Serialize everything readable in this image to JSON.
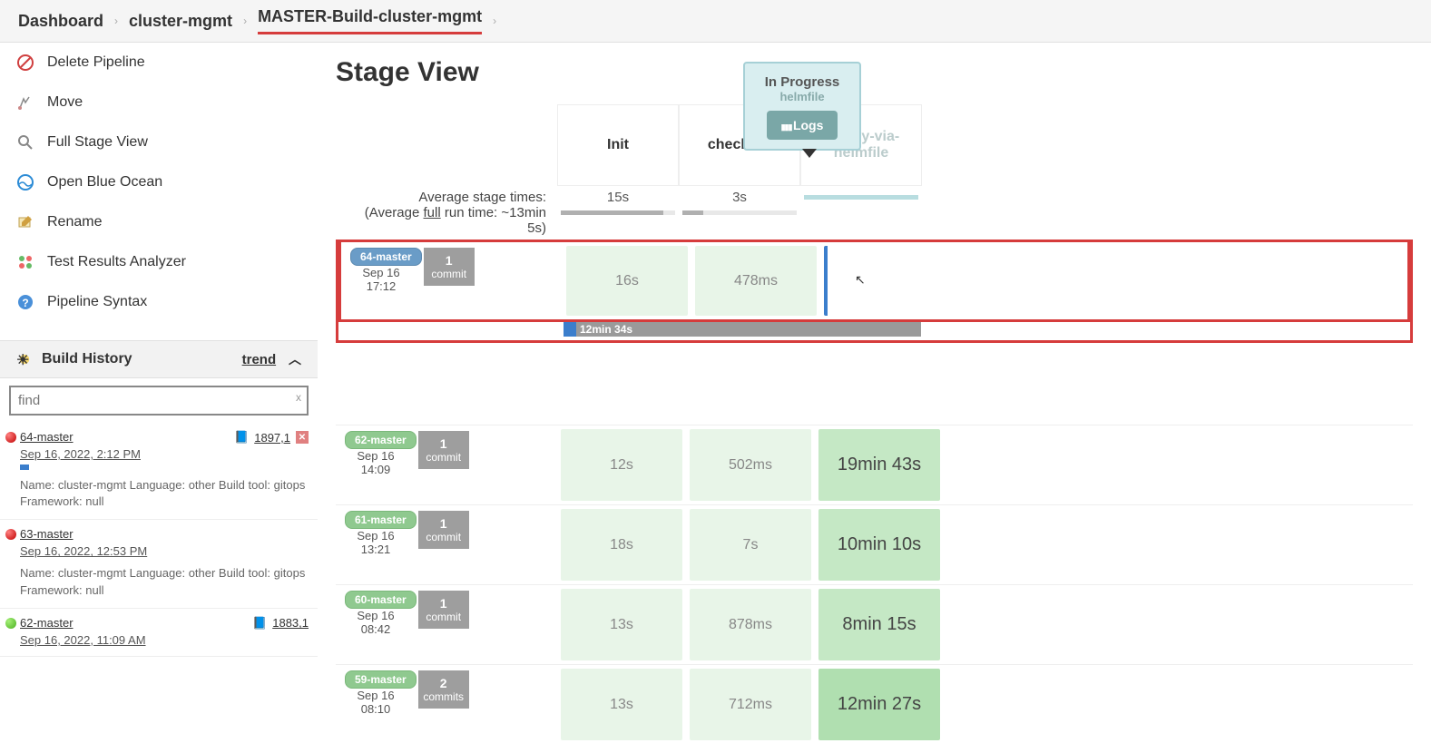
{
  "breadcrumb": [
    {
      "label": "Dashboard",
      "current": false
    },
    {
      "label": "cluster-mgmt",
      "current": false
    },
    {
      "label": "MASTER-Build-cluster-mgmt",
      "current": true
    }
  ],
  "sidebar": {
    "items": [
      {
        "label": "Delete Pipeline",
        "icon": "no-entry"
      },
      {
        "label": "Move",
        "icon": "move"
      },
      {
        "label": "Full Stage View",
        "icon": "magnify"
      },
      {
        "label": "Open Blue Ocean",
        "icon": "blue-ocean"
      },
      {
        "label": "Rename",
        "icon": "rename"
      },
      {
        "label": "Test Results Analyzer",
        "icon": "test"
      },
      {
        "label": "Pipeline Syntax",
        "icon": "help"
      }
    ]
  },
  "buildHistory": {
    "title": "Build History",
    "trend": "trend",
    "findPlaceholder": "find",
    "builds": [
      {
        "name": "64-master",
        "date": "Sep 16, 2022, 2:12 PM",
        "status": "red",
        "change": "1897,1",
        "cancel": true,
        "progress": true,
        "desc": "Name: cluster-mgmt Language: other Build tool: gitops Framework: null"
      },
      {
        "name": "63-master",
        "date": "Sep 16, 2022, 12:53 PM",
        "status": "red",
        "desc": "Name: cluster-mgmt Language: other Build tool: gitops Framework: null"
      },
      {
        "name": "62-master",
        "date": "Sep 16, 2022, 11:09 AM",
        "status": "green",
        "change": "1883,1"
      }
    ]
  },
  "stageView": {
    "title": "Stage View",
    "columns": [
      "Init",
      "checkout",
      "deploy-via-helmfile"
    ],
    "avgLabel1": "Average stage times:",
    "avgLabel2a": "(Average ",
    "avgLabel2b": "full",
    "avgLabel2c": " run time: ~13min 5s)",
    "avgTimes": [
      "15s",
      "3s",
      ""
    ],
    "inProgress": {
      "title": "In Progress",
      "subtitle": "helmfile",
      "logs": "Logs"
    },
    "rows": [
      {
        "tag": "64-master",
        "tagColor": "blue",
        "date": "Sep 16",
        "time": "17:12",
        "commits": "1",
        "commitLabel": "commit",
        "cells": [
          {
            "v": "16s",
            "cls": "cell-light"
          },
          {
            "v": "478ms",
            "cls": "cell-light"
          },
          {
            "v": "",
            "cls": "cell-blue-border"
          }
        ],
        "progress": "12min 34s",
        "highlighted": true
      },
      {
        "tag": "62-master",
        "tagColor": "green",
        "date": "Sep 16",
        "time": "14:09",
        "commits": "1",
        "commitLabel": "commit",
        "cells": [
          {
            "v": "12s",
            "cls": "cell-light"
          },
          {
            "v": "502ms",
            "cls": "cell-light"
          },
          {
            "v": "19min 43s",
            "cls": "cell-green"
          }
        ]
      },
      {
        "tag": "61-master",
        "tagColor": "green",
        "date": "Sep 16",
        "time": "13:21",
        "commits": "1",
        "commitLabel": "commit",
        "cells": [
          {
            "v": "18s",
            "cls": "cell-light"
          },
          {
            "v": "7s",
            "cls": "cell-light"
          },
          {
            "v": "10min 10s",
            "cls": "cell-green"
          }
        ]
      },
      {
        "tag": "60-master",
        "tagColor": "green",
        "date": "Sep 16",
        "time": "08:42",
        "commits": "1",
        "commitLabel": "commit",
        "cells": [
          {
            "v": "13s",
            "cls": "cell-light"
          },
          {
            "v": "878ms",
            "cls": "cell-light"
          },
          {
            "v": "8min 15s",
            "cls": "cell-green"
          }
        ]
      },
      {
        "tag": "59-master",
        "tagColor": "green",
        "date": "Sep 16",
        "time": "08:10",
        "commits": "2",
        "commitLabel": "commits",
        "cells": [
          {
            "v": "13s",
            "cls": "cell-light"
          },
          {
            "v": "712ms",
            "cls": "cell-light"
          },
          {
            "v": "12min 27s",
            "cls": "cell-green cell-dark-green"
          }
        ]
      }
    ]
  }
}
